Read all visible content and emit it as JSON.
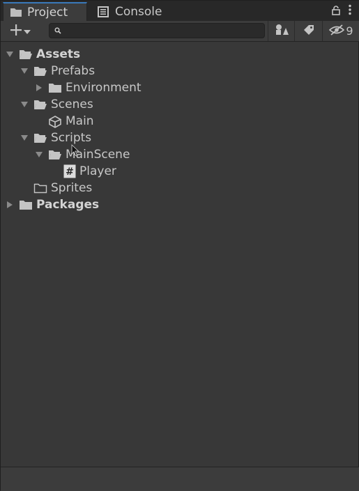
{
  "tabs": [
    {
      "label": "Project",
      "icon": "folder-icon",
      "active": true
    },
    {
      "label": "Console",
      "icon": "console-icon",
      "active": false
    }
  ],
  "window_controls": {
    "lock_icon": "lock-icon",
    "menu_icon": "kebab-menu-icon"
  },
  "toolbar": {
    "create_icon": "plus-icon",
    "search_placeholder": "",
    "search_value": "",
    "search_icon": "search-icon",
    "filter_by_type_icon": "type-filter-icon",
    "filter_by_label_icon": "label-tag-icon",
    "hidden_packages_icon": "eye-slash-icon",
    "hidden_packages_count": "9"
  },
  "tree": [
    {
      "label": "Assets",
      "icon": "folder-open-icon",
      "expanded": true,
      "bold": true,
      "depth": 0
    },
    {
      "label": "Prefabs",
      "icon": "folder-open-icon",
      "expanded": true,
      "depth": 1
    },
    {
      "label": "Environment",
      "icon": "folder-closed-icon",
      "expanded": false,
      "depth": 2
    },
    {
      "label": "Scenes",
      "icon": "folder-open-icon",
      "expanded": true,
      "depth": 1
    },
    {
      "label": "Main",
      "icon": "unity-scene-icon",
      "depth": 2
    },
    {
      "label": "Scripts",
      "icon": "folder-open-icon",
      "expanded": true,
      "depth": 1
    },
    {
      "label": "MainScene",
      "icon": "folder-open-icon",
      "expanded": true,
      "depth": 2
    },
    {
      "label": "Player",
      "icon": "csharp-script-icon",
      "depth": 3
    },
    {
      "label": "Sprites",
      "icon": "folder-empty-icon",
      "depth": 1
    },
    {
      "label": "Packages",
      "icon": "folder-closed-icon",
      "expanded": false,
      "bold": true,
      "depth": 0
    }
  ],
  "colors": {
    "panel_bg": "#383838",
    "tab_active_accent": "#3a79bb",
    "text": "#c8c8c8"
  }
}
